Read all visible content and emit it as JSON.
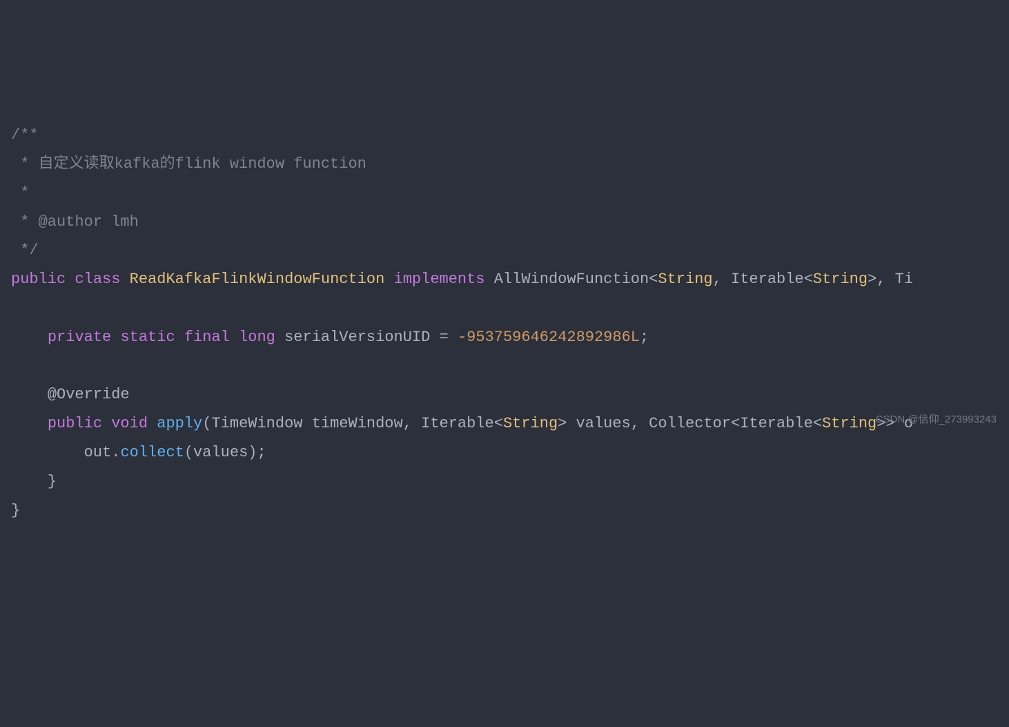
{
  "code": {
    "l1": "/**",
    "l2": " * 自定义读取kafka的flink window function",
    "l3": " *",
    "l4": " * @author lmh",
    "l5": " */",
    "kw_public": "public",
    "kw_class": "class",
    "cls_name": "ReadKafkaFlinkWindowFunction",
    "kw_implements": "implements",
    "plain_allwin": " AllWindowFunction<",
    "type_string": "String",
    "plain_iter1": ", Iterable<",
    "plain_close1": ">, Ti",
    "kw_private": "private",
    "kw_static": "static",
    "kw_final": "final",
    "kw_long": "long",
    "plain_svuid": " serialVersionUID = ",
    "num_svuid": "-953759646242892986L",
    "semi": ";",
    "annot_override": "@Override",
    "kw_void": "void",
    "method_apply": "apply",
    "plain_params1": "(TimeWindow timeWindow, Iterable<",
    "plain_params2": "> values, Collector<Iterable<",
    "plain_params3": ">> o",
    "plain_out": "        out.",
    "method_collect": "collect",
    "plain_collect_args": "(values);",
    "brace_close_in": "    }",
    "brace_close_out": "}"
  },
  "watermark": "CSDN @信仰_273993243"
}
